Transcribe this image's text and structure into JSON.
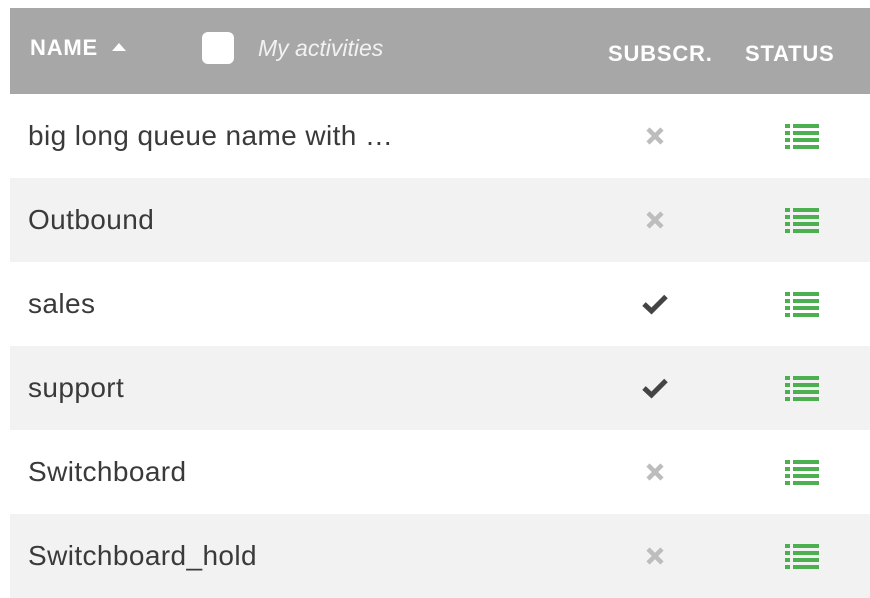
{
  "header": {
    "name_label": "NAME",
    "my_activities_label": "My activities",
    "subscr_label": "SUBSCR.",
    "status_label": "STATUS"
  },
  "colors": {
    "header_bg": "#a7a7a7",
    "row_alt_bg": "#f2f2f2",
    "status_green": "#4caf50",
    "cross_gray": "#bdbdbd",
    "check_dark": "#444444"
  },
  "rows": [
    {
      "name": "big long queue name with …",
      "subscribed": false,
      "status_icon": "list-icon"
    },
    {
      "name": "Outbound",
      "subscribed": false,
      "status_icon": "list-icon"
    },
    {
      "name": "sales",
      "subscribed": true,
      "status_icon": "list-icon"
    },
    {
      "name": "support",
      "subscribed": true,
      "status_icon": "list-icon"
    },
    {
      "name": "Switchboard",
      "subscribed": false,
      "status_icon": "list-icon"
    },
    {
      "name": "Switchboard_hold",
      "subscribed": false,
      "status_icon": "list-icon"
    }
  ]
}
